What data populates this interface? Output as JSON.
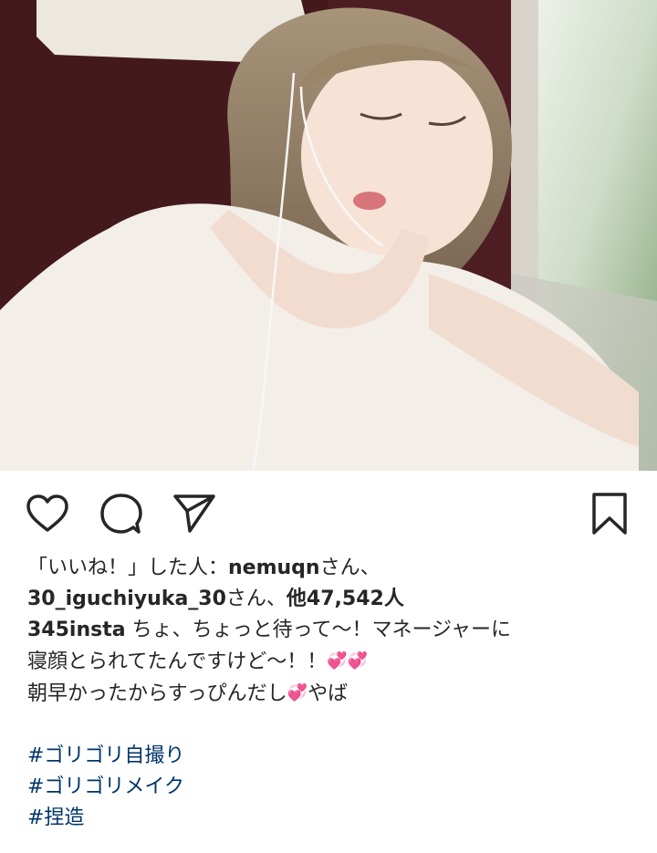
{
  "post": {
    "likes": {
      "prefix": "「いいね！」した人：",
      "user1": "nemuqn",
      "user1_suffix": "さん、",
      "user2": "30_iguchiyuka_30",
      "user2_suffix": "さん、",
      "others": "他47,542人"
    },
    "caption": {
      "username": "345insta",
      "line1": " ちょ、ちょっと待って〜！マネージャーに",
      "line2": "寝顔とられてたんですけど〜！！",
      "line2_emoji": "💞💞",
      "line3a": "朝早かったからすっぴんだし",
      "line3_emoji": "💞",
      "line3b": "やば"
    },
    "hashtags": [
      "#ゴリゴリ自撮り",
      "#ゴリゴリメイク",
      "#捏造"
    ]
  },
  "icons": [
    "heart-icon",
    "comment-icon",
    "share-icon",
    "bookmark-icon"
  ],
  "colors": {
    "text": "#262626",
    "hashtag": "#003569"
  }
}
